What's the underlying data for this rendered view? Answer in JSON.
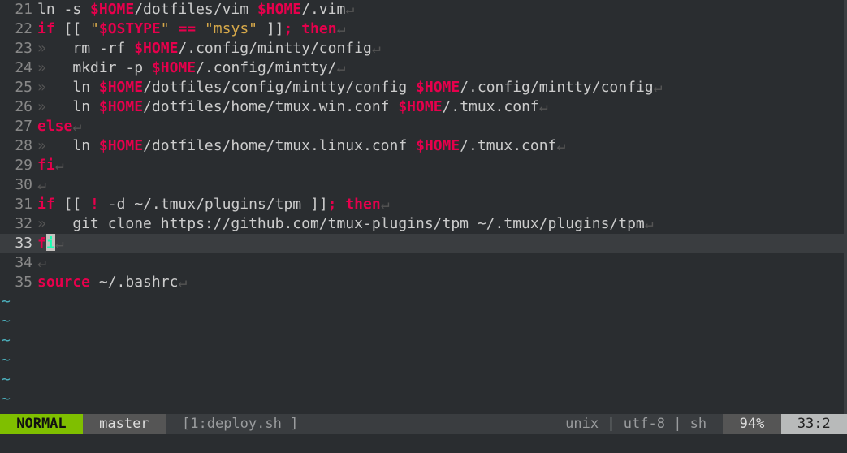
{
  "editor": {
    "first_line": 21,
    "cursor_line": 33,
    "cursor_col": 2,
    "listchars": {
      "tab": "»   ",
      "eol": "↵"
    },
    "lines": [
      {
        "n": 21,
        "tokens": [
          {
            "c": "fg",
            "t": "ln -s "
          },
          {
            "c": "var",
            "t": "$HOME"
          },
          {
            "c": "fg",
            "t": "/dotfiles/vim "
          },
          {
            "c": "var",
            "t": "$HOME"
          },
          {
            "c": "fg",
            "t": "/.vim"
          },
          {
            "c": "eol",
            "t": "↵"
          }
        ]
      },
      {
        "n": 22,
        "tokens": [
          {
            "c": "kw",
            "t": "if"
          },
          {
            "c": "fg",
            "t": " [[ "
          },
          {
            "c": "str",
            "t": "\""
          },
          {
            "c": "var",
            "t": "$OSTYPE"
          },
          {
            "c": "str",
            "t": "\""
          },
          {
            "c": "fg",
            "t": " "
          },
          {
            "c": "op",
            "t": "=="
          },
          {
            "c": "fg",
            "t": " "
          },
          {
            "c": "str",
            "t": "\"msys\""
          },
          {
            "c": "fg",
            "t": " ]]"
          },
          {
            "c": "op",
            "t": ";"
          },
          {
            "c": "fg",
            "t": " "
          },
          {
            "c": "kw",
            "t": "then"
          },
          {
            "c": "eol",
            "t": "↵"
          }
        ]
      },
      {
        "n": 23,
        "tokens": [
          {
            "c": "ws",
            "t": "»   "
          },
          {
            "c": "fg",
            "t": "rm -rf "
          },
          {
            "c": "var",
            "t": "$HOME"
          },
          {
            "c": "fg",
            "t": "/.config/mintty/config"
          },
          {
            "c": "eol",
            "t": "↵"
          }
        ]
      },
      {
        "n": 24,
        "tokens": [
          {
            "c": "ws",
            "t": "»   "
          },
          {
            "c": "fg",
            "t": "mkdir -p "
          },
          {
            "c": "var",
            "t": "$HOME"
          },
          {
            "c": "fg",
            "t": "/.config/mintty/"
          },
          {
            "c": "eol",
            "t": "↵"
          }
        ]
      },
      {
        "n": 25,
        "tokens": [
          {
            "c": "ws",
            "t": "»   "
          },
          {
            "c": "fg",
            "t": "ln "
          },
          {
            "c": "var",
            "t": "$HOME"
          },
          {
            "c": "fg",
            "t": "/dotfiles/config/mintty/config "
          },
          {
            "c": "var",
            "t": "$HOME"
          },
          {
            "c": "fg",
            "t": "/.config/mintty/config"
          },
          {
            "c": "eol",
            "t": "↵"
          }
        ]
      },
      {
        "n": 26,
        "tokens": [
          {
            "c": "ws",
            "t": "»   "
          },
          {
            "c": "fg",
            "t": "ln "
          },
          {
            "c": "var",
            "t": "$HOME"
          },
          {
            "c": "fg",
            "t": "/dotfiles/home/tmux.win.conf "
          },
          {
            "c": "var",
            "t": "$HOME"
          },
          {
            "c": "fg",
            "t": "/.tmux.conf"
          },
          {
            "c": "eol",
            "t": "↵"
          }
        ]
      },
      {
        "n": 27,
        "tokens": [
          {
            "c": "kw",
            "t": "else"
          },
          {
            "c": "eol",
            "t": "↵"
          }
        ]
      },
      {
        "n": 28,
        "tokens": [
          {
            "c": "ws",
            "t": "»   "
          },
          {
            "c": "fg",
            "t": "ln "
          },
          {
            "c": "var",
            "t": "$HOME"
          },
          {
            "c": "fg",
            "t": "/dotfiles/home/tmux.linux.conf "
          },
          {
            "c": "var",
            "t": "$HOME"
          },
          {
            "c": "fg",
            "t": "/.tmux.conf"
          },
          {
            "c": "eol",
            "t": "↵"
          }
        ]
      },
      {
        "n": 29,
        "tokens": [
          {
            "c": "kw",
            "t": "fi"
          },
          {
            "c": "eol",
            "t": "↵"
          }
        ]
      },
      {
        "n": 30,
        "tokens": [
          {
            "c": "eol",
            "t": "↵"
          }
        ]
      },
      {
        "n": 31,
        "tokens": [
          {
            "c": "kw",
            "t": "if"
          },
          {
            "c": "fg",
            "t": " [[ "
          },
          {
            "c": "op",
            "t": "!"
          },
          {
            "c": "fg",
            "t": " -d ~/.tmux/plugins/tpm ]]"
          },
          {
            "c": "op",
            "t": ";"
          },
          {
            "c": "fg",
            "t": " "
          },
          {
            "c": "kw",
            "t": "then"
          },
          {
            "c": "eol",
            "t": "↵"
          }
        ]
      },
      {
        "n": 32,
        "tokens": [
          {
            "c": "ws",
            "t": "»   "
          },
          {
            "c": "fg",
            "t": "git clone https://github.com/tmux-plugins/tpm ~/.tmux/plugins/tpm"
          },
          {
            "c": "eol",
            "t": "↵"
          }
        ]
      },
      {
        "n": 33,
        "cursor": true,
        "cursor_after_token_index": 0,
        "tokens": [
          {
            "c": "kw",
            "t": "fi"
          },
          {
            "c": "eol",
            "t": "↵"
          }
        ]
      },
      {
        "n": 34,
        "tokens": [
          {
            "c": "eol",
            "t": "↵"
          }
        ]
      },
      {
        "n": 35,
        "tokens": [
          {
            "c": "kw",
            "t": "source"
          },
          {
            "c": "fg",
            "t": " ~/.bashrc"
          },
          {
            "c": "eol",
            "t": "↵"
          }
        ]
      }
    ],
    "tilde_rows": 6,
    "tilde_glyph": "~"
  },
  "statusline": {
    "mode": " NORMAL ",
    "branch": " master ",
    "file": " [1:deploy.sh ]",
    "info": "unix | utf-8 | sh ",
    "percent": " 94% ",
    "position": " 33:2 "
  }
}
